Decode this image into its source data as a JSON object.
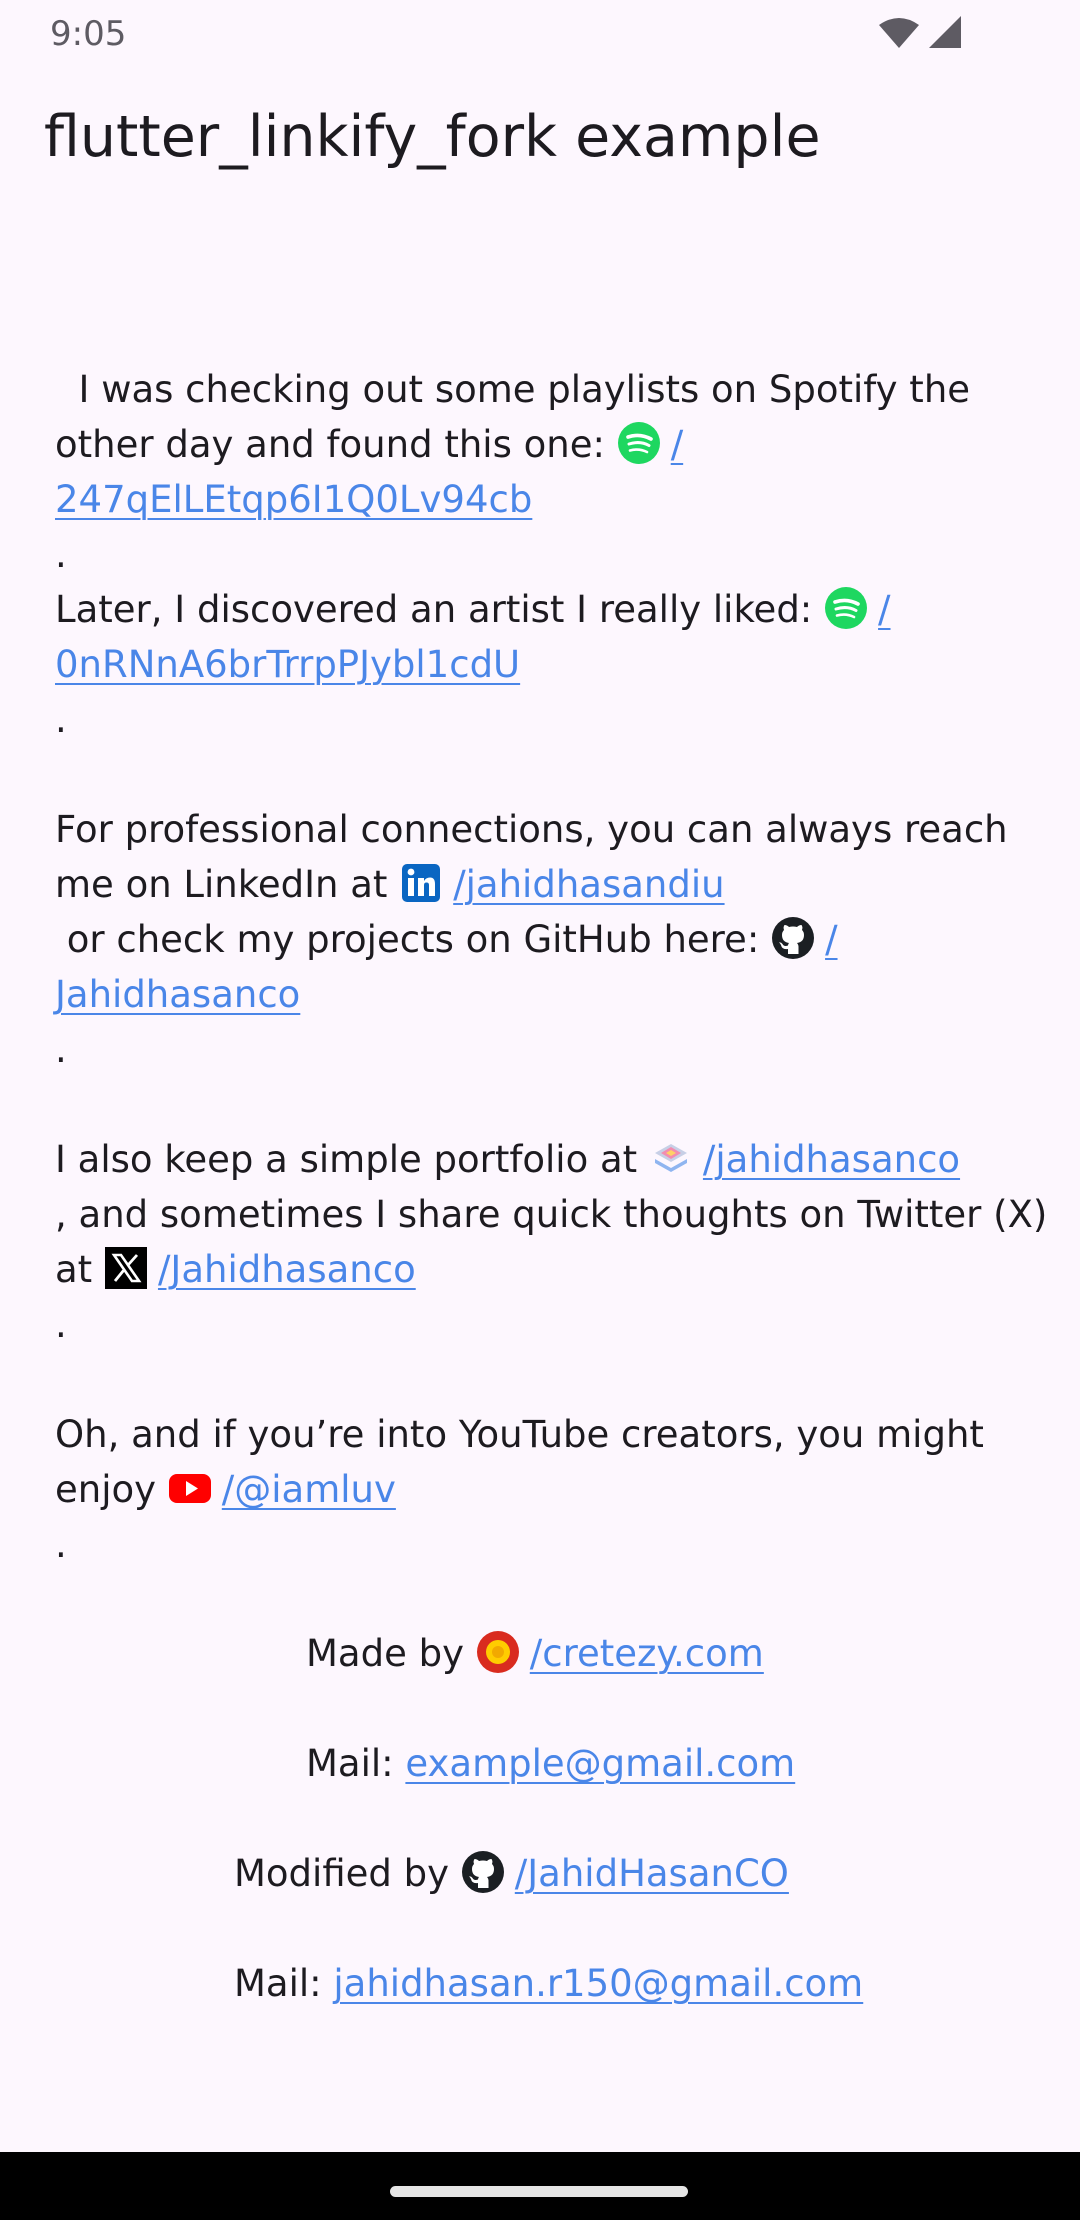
{
  "status_bar": {
    "time": "9:05"
  },
  "app_bar": {
    "title": "flutter_linkify_fork example"
  },
  "body": {
    "p1": {
      "line1": "  I was checking out some playlists on Spotify the",
      "line2_text": "other day and found this one:",
      "spotify_playlist_link_a": "/",
      "spotify_playlist_link_b": "247qElLEtqp6I1Q0Lv94cb",
      "dot": "."
    },
    "p2": {
      "text": "Later, I discovered an artist I really liked:",
      "spotify_artist_link_a": "/",
      "spotify_artist_link_b": "0nRNnA6brTrrpPJybl1cdU",
      "dot": "."
    },
    "p3": {
      "line1": "For professional connections, you can always reach",
      "line2_text": "me on LinkedIn at",
      "linkedin_link": "/jahidhasandiu",
      "line3_text": " or check my projects on GitHub here:",
      "github_link_a": "/",
      "github_link_b": "Jahidhasanco",
      "dot": "."
    },
    "p4": {
      "line1_text": "I also keep a simple portfolio at",
      "portfolio_link": "/jahidhasanco",
      "line2": ", and sometimes I share quick thoughts on Twitter (X)",
      "line3_text": "at",
      "twitter_link": "/Jahidhasanco",
      "dot": "."
    },
    "p5": {
      "line1": "Oh, and if you’re into YouTube creators, you might",
      "line2_text": "enjoy",
      "youtube_link": "/@iamluv",
      "dot": "."
    }
  },
  "footer": {
    "made_by_label": "Made by",
    "made_by_link": "/cretezy.com",
    "mail1_label": "Mail:",
    "mail1_link": "example@gmail.com",
    "modified_by_label": "Modified by",
    "modified_by_link": "/JahidHasanCO",
    "mail2_label": "Mail:",
    "mail2_link": "jahidhasan.r150@gmail.com"
  },
  "icons": {
    "spotify": "spotify-icon",
    "linkedin": "linkedin-icon",
    "github": "github-icon",
    "portfolio": "portfolio-icon",
    "twitter": "x-twitter-icon",
    "youtube": "youtube-icon",
    "cretezy": "cretezy-icon"
  },
  "colors": {
    "background": "#fdf7fe",
    "link": "#4a86e8",
    "spotify": "#1ed760",
    "linkedin": "#0a66c2",
    "youtube": "#ff0000"
  }
}
